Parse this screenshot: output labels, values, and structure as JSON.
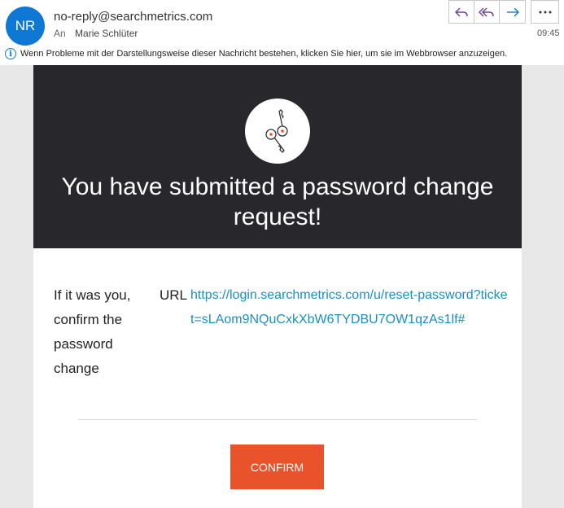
{
  "header": {
    "avatar_initials": "NR",
    "sender": "no-reply@searchmetrics.com",
    "to_label": "An",
    "recipient": "Marie Schlüter",
    "time": "09:45",
    "actions": [
      "reply",
      "reply-all",
      "forward",
      "more"
    ]
  },
  "infobar": {
    "text": "Wenn Probleme mit der Darstellungsweise dieser Nachricht bestehen, klicken Sie hier, um sie im Webbrowser anzuzeigen."
  },
  "email": {
    "hero_title": "You have submitted a password change request!",
    "message": "If it was you, confirm the password change",
    "url_label": "URL",
    "url": "https://login.searchmetrics.com/u/reset-password?ticket=sLAom9NQuCxkXbW6TYDBU7OW1qzAs1lf#",
    "confirm_label": "CONFIRM"
  },
  "colors": {
    "avatar": "#0f78d4",
    "hero_bg": "#28272b",
    "link": "#1a8fc4",
    "confirm_bg": "#e8532b"
  }
}
